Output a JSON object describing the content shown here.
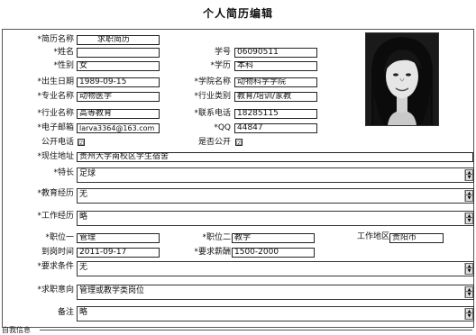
{
  "page": {
    "title": "个人简历编辑"
  },
  "fields": {
    "resume_name": {
      "label": "*简历名称",
      "value": "求职简历"
    },
    "name": {
      "label": "*姓名",
      "value": ""
    },
    "student_id": {
      "label": "学号",
      "value": "06090511"
    },
    "gender": {
      "label": "*性别",
      "value": "女"
    },
    "education": {
      "label": "*学历",
      "value": "本科"
    },
    "birth_date": {
      "label": "*出生日期",
      "value": "1989-09-15"
    },
    "college": {
      "label": "*学院名称",
      "value": "动物科学学院"
    },
    "major": {
      "label": "*专业名称",
      "value": "动物医学"
    },
    "industry_category": {
      "label": "*行业类别",
      "value": "教育/培训/家教"
    },
    "industry_name": {
      "label": "*行业名称",
      "value": "高等教育"
    },
    "phone": {
      "label": "*联系电话",
      "value": "18285115"
    },
    "email": {
      "label": "*电子邮箱",
      "value": "larva3364@163.com"
    },
    "qq": {
      "label": "*QQ",
      "value": "44847"
    },
    "public_phone": {
      "label": "公开电话",
      "checked": "☑"
    },
    "is_public": {
      "label": "是否公开",
      "checked": "☑"
    },
    "address": {
      "label": "*现住地址",
      "value": "贵州大学南校区学生宿舍"
    },
    "specialty": {
      "label": "*特长",
      "value": "足球"
    },
    "education_history": {
      "label": "*教育经历",
      "value": "无"
    },
    "work_history": {
      "label": "*工作经历",
      "value": "略"
    },
    "position_one": {
      "label": "*职位一",
      "value": "管理"
    },
    "position_two": {
      "label": "*职位二",
      "value": "教学"
    },
    "work_area": {
      "label": "工作地区",
      "value": "贵阳市"
    },
    "start_date": {
      "label": "到岗时间",
      "value": "2011-09-17"
    },
    "salary": {
      "label": "*要求薪酬",
      "value": "1500-2000"
    },
    "requirements": {
      "label": "*要求条件",
      "value": "无"
    },
    "job_intention": {
      "label": "*求职意向",
      "value": "管理或教学类岗位"
    },
    "remarks": {
      "label": "备注",
      "value": "略"
    }
  },
  "section": {
    "self_eval": "自我信息"
  },
  "icons": {
    "scroll_up": "▲",
    "scroll_down": "▼",
    "photo": "user-photo"
  }
}
